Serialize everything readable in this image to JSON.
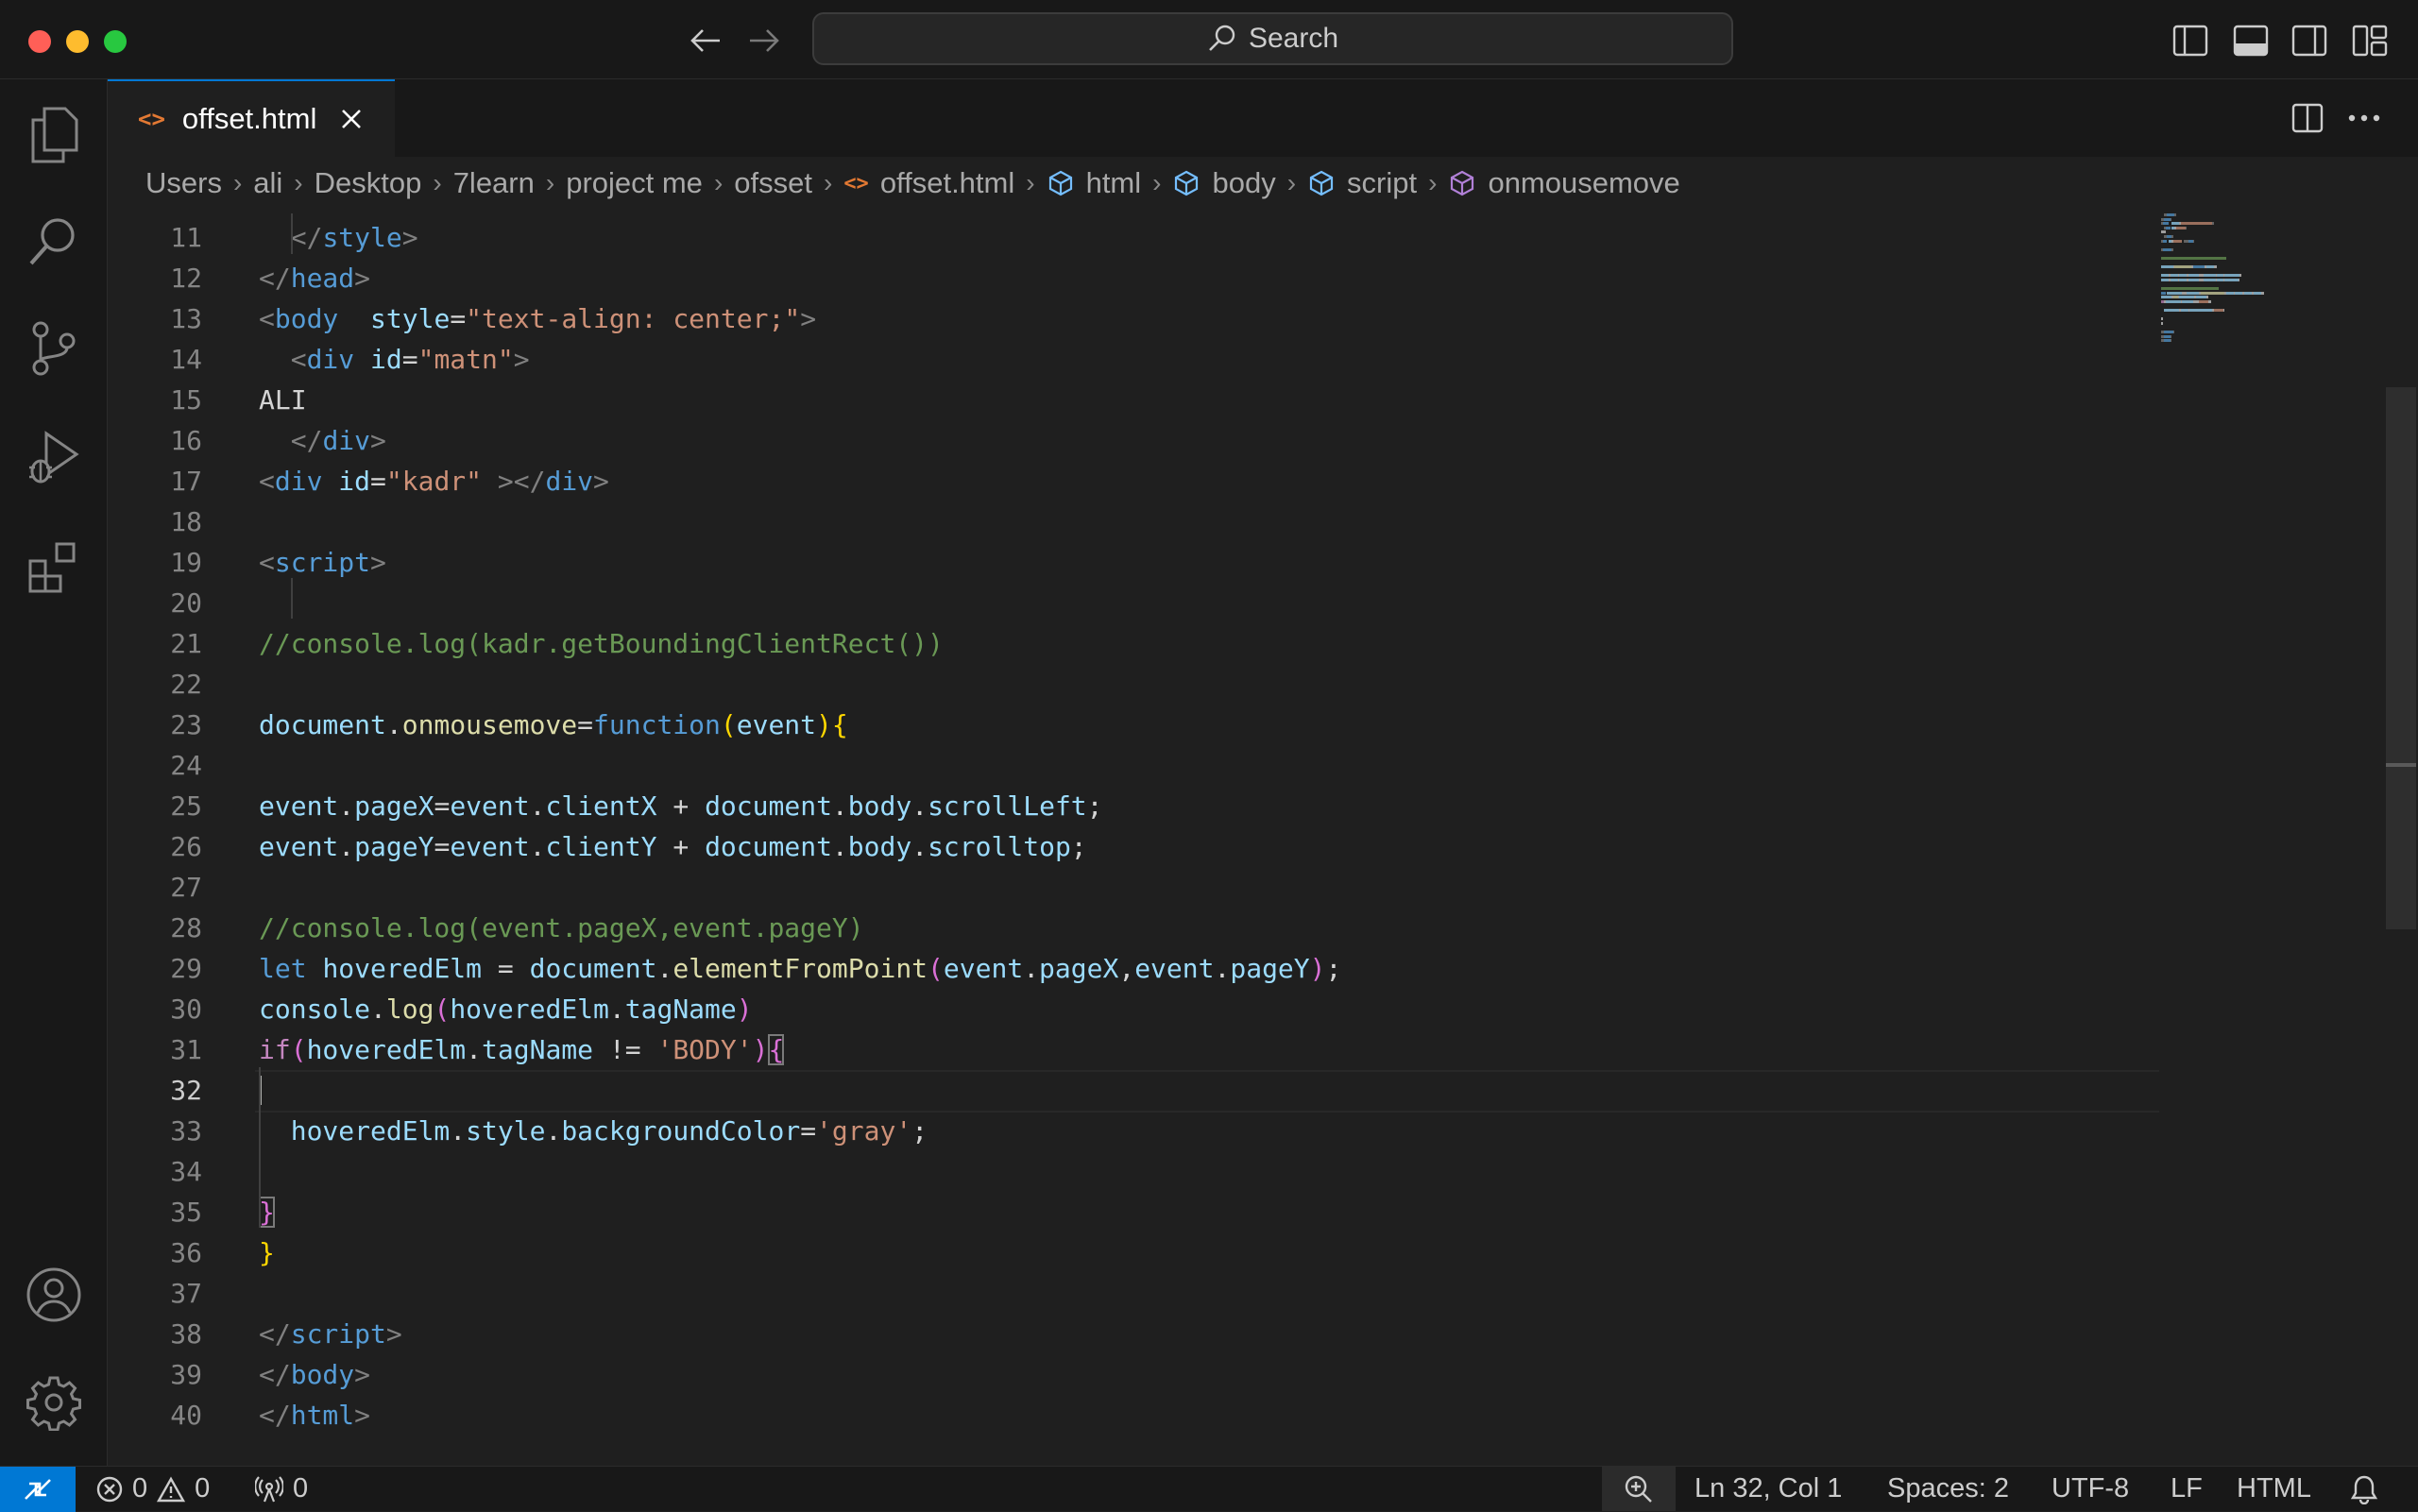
{
  "search": {
    "label": "Search"
  },
  "tab": {
    "icon": "<>",
    "label": "offset.html"
  },
  "breadcrumb": {
    "items": [
      "Users",
      "ali",
      "Desktop",
      "7learn",
      "project me",
      "ofsset"
    ],
    "file_icon": "<>",
    "file": "offset.html",
    "symbols": [
      "html",
      "body",
      "script",
      "onmousemove"
    ]
  },
  "editor": {
    "active_line": 32,
    "lines": [
      {
        "n": "11",
        "t": [
          [
            "",
            "  "
          ],
          [
            "pun",
            "</"
          ],
          [
            "tag",
            "style"
          ],
          [
            "pun",
            ">"
          ]
        ]
      },
      {
        "n": "12",
        "t": [
          [
            "pun",
            "</"
          ],
          [
            "tag",
            "head"
          ],
          [
            "pun",
            ">"
          ]
        ]
      },
      {
        "n": "13",
        "t": [
          [
            "pun",
            "<"
          ],
          [
            "tag",
            "body"
          ],
          [
            "",
            "  "
          ],
          [
            "attr",
            "style"
          ],
          [
            "txt",
            "="
          ],
          [
            "str",
            "\"text-align: center;\""
          ],
          [
            "pun",
            ">"
          ]
        ]
      },
      {
        "n": "14",
        "t": [
          [
            "",
            "  "
          ],
          [
            "pun",
            "<"
          ],
          [
            "tag",
            "div"
          ],
          [
            "txt",
            " "
          ],
          [
            "attr",
            "id"
          ],
          [
            "txt",
            "="
          ],
          [
            "str",
            "\"matn\""
          ],
          [
            "pun",
            ">"
          ]
        ]
      },
      {
        "n": "15",
        "t": [
          [
            "txt",
            "ALI"
          ]
        ]
      },
      {
        "n": "16",
        "t": [
          [
            "",
            "  "
          ],
          [
            "pun",
            "</"
          ],
          [
            "tag",
            "div"
          ],
          [
            "pun",
            ">"
          ]
        ]
      },
      {
        "n": "17",
        "t": [
          [
            "pun",
            "<"
          ],
          [
            "tag",
            "div"
          ],
          [
            "txt",
            " "
          ],
          [
            "attr",
            "id"
          ],
          [
            "txt",
            "="
          ],
          [
            "str",
            "\"kadr\""
          ],
          [
            "txt",
            " "
          ],
          [
            "pun",
            "></"
          ],
          [
            "tag",
            "div"
          ],
          [
            "pun",
            ">"
          ]
        ]
      },
      {
        "n": "18",
        "t": []
      },
      {
        "n": "19",
        "t": [
          [
            "pun",
            "<"
          ],
          [
            "tag",
            "script"
          ],
          [
            "pun",
            ">"
          ]
        ]
      },
      {
        "n": "20",
        "t": []
      },
      {
        "n": "21",
        "t": [
          [
            "cmt",
            "//console.log(kadr.getBoundingClientRect())"
          ]
        ]
      },
      {
        "n": "22",
        "t": []
      },
      {
        "n": "23",
        "t": [
          [
            "vr",
            "document"
          ],
          [
            "txt",
            "."
          ],
          [
            "fn",
            "onmousemove"
          ],
          [
            "txt",
            "="
          ],
          [
            "kw",
            "function"
          ],
          [
            "b1",
            "("
          ],
          [
            "vr",
            "event"
          ],
          [
            "b1",
            ")"
          ],
          [
            "b1",
            "{"
          ]
        ]
      },
      {
        "n": "24",
        "t": []
      },
      {
        "n": "25",
        "t": [
          [
            "vr",
            "event"
          ],
          [
            "txt",
            "."
          ],
          [
            "vr",
            "pageX"
          ],
          [
            "txt",
            "="
          ],
          [
            "vr",
            "event"
          ],
          [
            "txt",
            "."
          ],
          [
            "vr",
            "clientX"
          ],
          [
            "txt",
            " + "
          ],
          [
            "vr",
            "document"
          ],
          [
            "txt",
            "."
          ],
          [
            "vr",
            "body"
          ],
          [
            "txt",
            "."
          ],
          [
            "vr",
            "scrollLeft"
          ],
          [
            "txt",
            ";"
          ]
        ]
      },
      {
        "n": "26",
        "t": [
          [
            "vr",
            "event"
          ],
          [
            "txt",
            "."
          ],
          [
            "vr",
            "pageY"
          ],
          [
            "txt",
            "="
          ],
          [
            "vr",
            "event"
          ],
          [
            "txt",
            "."
          ],
          [
            "vr",
            "clientY"
          ],
          [
            "txt",
            " + "
          ],
          [
            "vr",
            "document"
          ],
          [
            "txt",
            "."
          ],
          [
            "vr",
            "body"
          ],
          [
            "txt",
            "."
          ],
          [
            "vr",
            "scrolltop"
          ],
          [
            "txt",
            ";"
          ]
        ]
      },
      {
        "n": "27",
        "t": []
      },
      {
        "n": "28",
        "t": [
          [
            "cmt",
            "//console.log(event.pageX,event.pageY)"
          ]
        ]
      },
      {
        "n": "29",
        "t": [
          [
            "kw",
            "let"
          ],
          [
            "txt",
            " "
          ],
          [
            "vr",
            "hoveredElm"
          ],
          [
            "txt",
            " = "
          ],
          [
            "vr",
            "document"
          ],
          [
            "txt",
            "."
          ],
          [
            "fn",
            "elementFromPoint"
          ],
          [
            "b2",
            "("
          ],
          [
            "vr",
            "event"
          ],
          [
            "txt",
            "."
          ],
          [
            "vr",
            "pageX"
          ],
          [
            "txt",
            ","
          ],
          [
            "vr",
            "event"
          ],
          [
            "txt",
            "."
          ],
          [
            "vr",
            "pageY"
          ],
          [
            "b2",
            ")"
          ],
          [
            "txt",
            ";"
          ]
        ]
      },
      {
        "n": "30",
        "t": [
          [
            "vr",
            "console"
          ],
          [
            "txt",
            "."
          ],
          [
            "fn",
            "log"
          ],
          [
            "b2",
            "("
          ],
          [
            "vr",
            "hoveredElm"
          ],
          [
            "txt",
            "."
          ],
          [
            "vr",
            "tagName"
          ],
          [
            "b2",
            ")"
          ]
        ]
      },
      {
        "n": "31",
        "t": [
          [
            "ctl",
            "if"
          ],
          [
            "b2",
            "("
          ],
          [
            "vr",
            "hoveredElm"
          ],
          [
            "txt",
            "."
          ],
          [
            "vr",
            "tagName"
          ],
          [
            "txt",
            " != "
          ],
          [
            "str",
            "'BODY'"
          ],
          [
            "b2",
            ")"
          ],
          [
            "b2 bracket-match",
            "{"
          ]
        ]
      },
      {
        "n": "32",
        "t": []
      },
      {
        "n": "33",
        "t": [
          [
            "",
            "  "
          ],
          [
            "vr",
            "hoveredElm"
          ],
          [
            "txt",
            "."
          ],
          [
            "vr",
            "style"
          ],
          [
            "txt",
            "."
          ],
          [
            "vr",
            "backgroundColor"
          ],
          [
            "txt",
            "="
          ],
          [
            "str",
            "'gray'"
          ],
          [
            "txt",
            ";"
          ]
        ]
      },
      {
        "n": "34",
        "t": []
      },
      {
        "n": "35",
        "t": [
          [
            "b2 bracket-match",
            "}"
          ]
        ]
      },
      {
        "n": "36",
        "t": [
          [
            "b1",
            "}"
          ]
        ]
      },
      {
        "n": "37",
        "t": []
      },
      {
        "n": "38",
        "t": [
          [
            "pun",
            "</"
          ],
          [
            "tag",
            "script"
          ],
          [
            "pun",
            ">"
          ]
        ]
      },
      {
        "n": "39",
        "t": [
          [
            "pun",
            "</"
          ],
          [
            "tag",
            "body"
          ],
          [
            "pun",
            ">"
          ]
        ]
      },
      {
        "n": "40",
        "t": [
          [
            "pun",
            "</"
          ],
          [
            "tag",
            "html"
          ],
          [
            "pun",
            ">"
          ]
        ]
      }
    ]
  },
  "status": {
    "errors": "0",
    "warnings": "0",
    "ports": "0",
    "position": "Ln 32, Col 1",
    "spaces": "Spaces: 2",
    "encoding": "UTF-8",
    "eol": "LF",
    "language": "HTML"
  },
  "colors": {
    "accent": "#0078d4",
    "background": "#1f1f1f",
    "chrome": "#181818"
  }
}
